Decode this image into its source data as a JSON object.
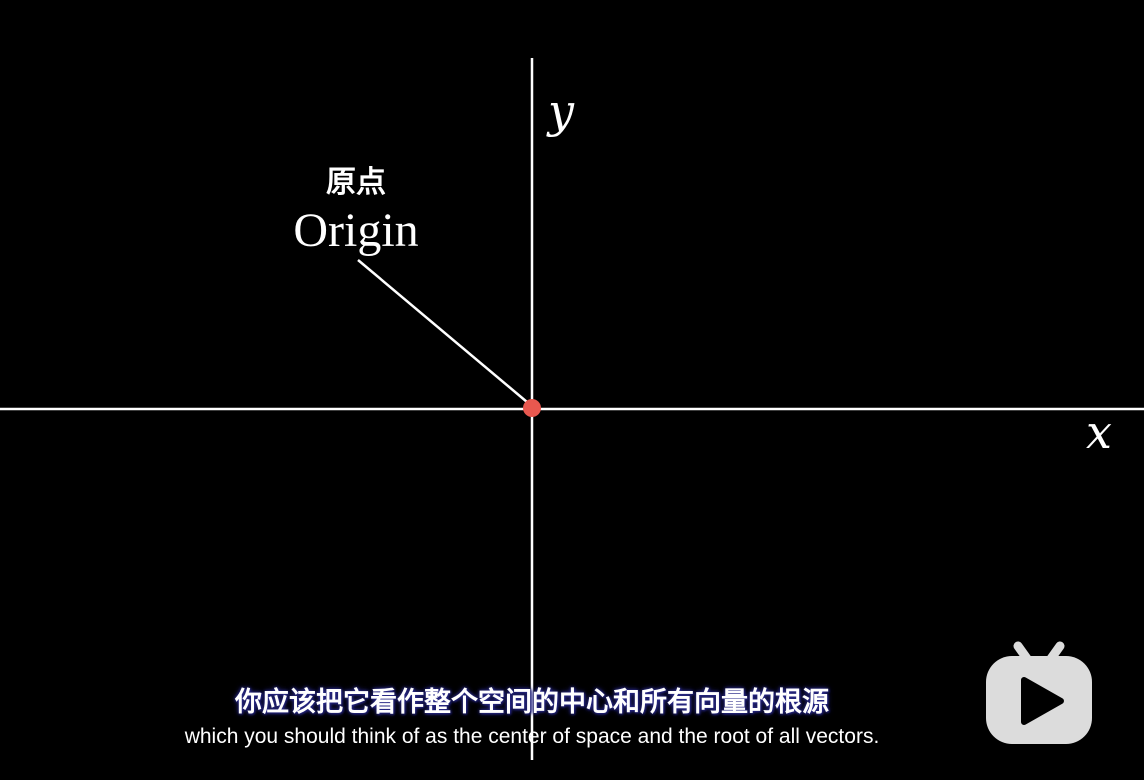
{
  "diagram": {
    "axis_x_label": "x",
    "axis_y_label": "y",
    "origin_label_cn": "原点",
    "origin_label_en": "Origin",
    "origin_color": "#e8584f",
    "axis_color": "#ffffff"
  },
  "subtitles": {
    "chinese": "你应该把它看作整个空间的中心和所有向量的根源",
    "english": "which you should think of as the center of space and the root of all vectors."
  },
  "overlay": {
    "icon": "play-badge-icon",
    "color": "#dcdcdc"
  }
}
